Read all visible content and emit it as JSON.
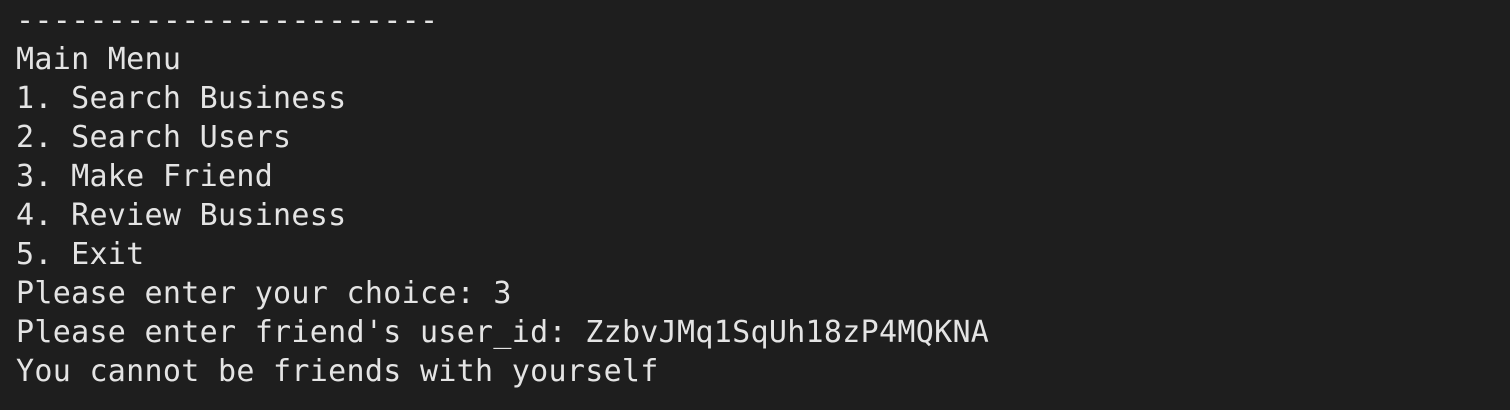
{
  "terminal": {
    "separator": "-----------------------",
    "menu_title": "Main Menu",
    "menu_items": [
      "1. Search Business",
      "2. Search Users",
      "3. Make Friend",
      "4. Review Business",
      "5. Exit"
    ],
    "choice_prompt": "Please enter your choice: ",
    "choice_value": "3",
    "friend_prompt": "Please enter friend's user_id: ",
    "friend_value": "ZzbvJMq1SqUh18zP4MQKNA",
    "message": "You cannot be friends with yourself"
  },
  "colors": {
    "background": "#1e1e1e",
    "text": "#e4e4e4"
  }
}
